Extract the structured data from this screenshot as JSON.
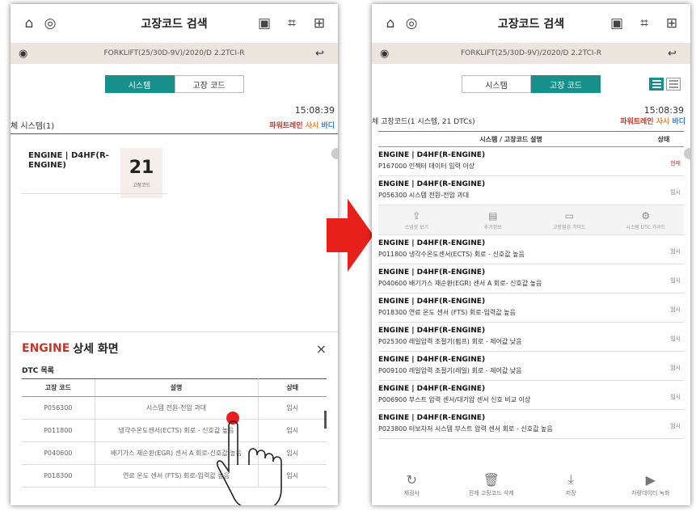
{
  "left": {
    "title": "고장코드 검색",
    "vehicle": "FORKLIFT(25/30D-9V)/2020/D 2.2TCI-R",
    "tabs": [
      "시스템",
      "고장 코드"
    ],
    "time": "15:08:39",
    "section_label": "체 시스템(1)",
    "categories": [
      "파워트레인",
      "사시",
      "바디"
    ],
    "card": {
      "name": "ENGINE | D4HF(R-ENGINE)",
      "count": "21",
      "count_label": "고장코드"
    },
    "detail": {
      "title_system": "ENGINE",
      "title_rest": "상세 화면",
      "close": "×",
      "dtc_label": "DTC 목록",
      "headers": [
        "고장 코드",
        "설명",
        "상태"
      ],
      "rows": [
        {
          "code": "P056300",
          "desc": "시스템 전원-전압 과대",
          "status": "임시"
        },
        {
          "code": "P011800",
          "desc": "냉각수온도센서(ECTS) 회로 - 신호값 높음",
          "status": "임시"
        },
        {
          "code": "P040600",
          "desc": "배기가스 재순환(EGR) 센서 A 회로-신호값 높음",
          "status": "임시"
        },
        {
          "code": "P018300",
          "desc": "연료 온도 센서 (FTS) 회로-입력값 높음",
          "status": "임시"
        }
      ]
    }
  },
  "right": {
    "title": "고장코드 검색",
    "vehicle": "FORKLIFT(25/30D-9V)/2020/D 2.2TCI-R",
    "tabs": [
      "시스템",
      "고장 코드"
    ],
    "time": "15:08:39",
    "section_label": "체 고장코드(1 시스템, 21 DTCs)",
    "categories": [
      "파워트레인",
      "사시",
      "바디"
    ],
    "col_desc": "시스템 / 고장코드 설명",
    "col_status": "상태",
    "actions": [
      "스냅샷 보기",
      "추가정보",
      "고장점검 가이드",
      "시스템 DTC 가이드"
    ],
    "items": [
      {
        "system": "ENGINE | D4HF(R-ENGINE)",
        "dtc": "P167000 인젝터 데이터 입력 이상",
        "status": "현재",
        "current": true
      },
      {
        "system": "ENGINE | D4HF(R-ENGINE)",
        "dtc": "P056300 시스템 전원-전압 과대",
        "status": "임시"
      },
      {
        "system": "ENGINE | D4HF(R-ENGINE)",
        "dtc": "P011800 냉각수온도센서(ECTS) 회로 - 신호값 높음",
        "status": "임시"
      },
      {
        "system": "ENGINE | D4HF(R-ENGINE)",
        "dtc": "P040600 배기가스 재순환(EGR) 센서 A 회로- 신호값 높음",
        "status": "임시"
      },
      {
        "system": "ENGINE | D4HF(R-ENGINE)",
        "dtc": "P018300 연료 온도 센서 (FTS) 회로-입력값 높음",
        "status": "임시"
      },
      {
        "system": "ENGINE | D4HF(R-ENGINE)",
        "dtc": "P025300 레일압력 조절기(펌프) 회로 - 제어값 낮음",
        "status": "임시"
      },
      {
        "system": "ENGINE | D4HF(R-ENGINE)",
        "dtc": "P009100 레일압력 조절기(레일) 회로 - 제어값 낮음",
        "status": "임시"
      },
      {
        "system": "ENGINE | D4HF(R-ENGINE)",
        "dtc": "P006900 부스트 압력 센서/대기압 센서 신호 비교 이상",
        "status": "임시"
      },
      {
        "system": "ENGINE | D4HF(R-ENGINE)",
        "dtc": "P023800 터보차저 시스템 부스트 압력 센서 회로 - 신호값 높음",
        "status": "임시"
      }
    ],
    "bottom": [
      "재검사",
      "전체 고장코드 삭제",
      "저장",
      "차량데이터 녹화"
    ]
  },
  "colors": {
    "teal": "#17908c",
    "red": "#e8201b",
    "powertrain": "#c0392b",
    "chassis": "#e67e22",
    "body": "#2e86de"
  },
  "icons": [
    "home-icon",
    "vci-icon",
    "bluetooth-icon",
    "screen-capture-icon",
    "menu-grid-icon",
    "vehicle-icon",
    "back-icon",
    "arrow-icon",
    "hand-pointer-icon"
  ]
}
